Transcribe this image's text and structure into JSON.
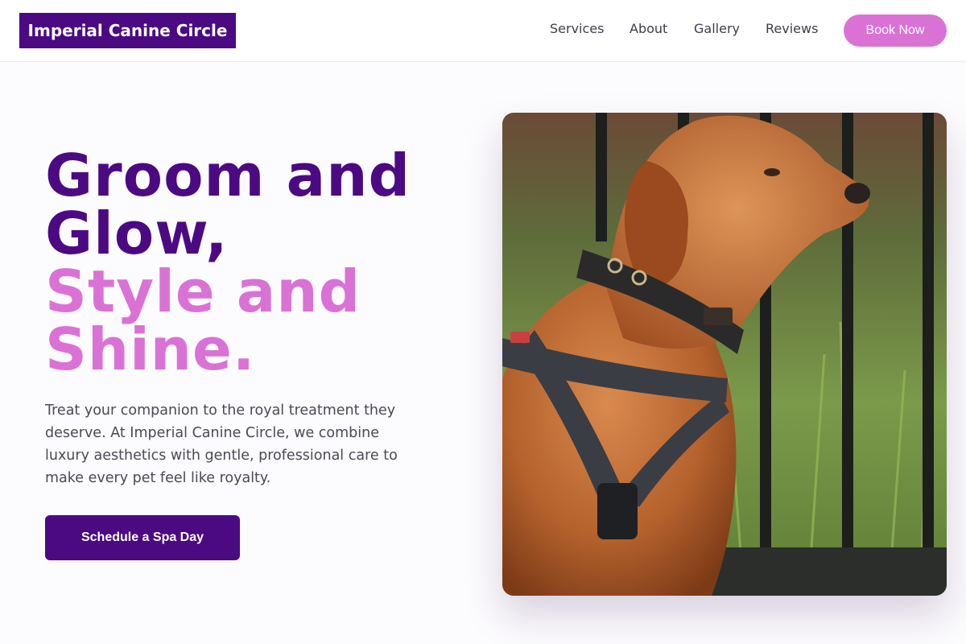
{
  "brand": {
    "name": "Imperial Canine Circle"
  },
  "nav": {
    "items": [
      {
        "label": "Services"
      },
      {
        "label": "About"
      },
      {
        "label": "Gallery"
      },
      {
        "label": "Reviews"
      }
    ],
    "cta_label": "Book Now"
  },
  "hero": {
    "title_line1": "Groom and",
    "title_line2": "Glow,",
    "title_line3": "Style and",
    "title_line4": "Shine.",
    "description": "Treat your companion to the royal treatment they deserve. At Imperial Canine Circle, we combine luxury aesthetics with gentle, professional care to make every pet feel like royalty.",
    "cta_label": "Schedule a Spa Day",
    "image": "photo of a red-coated dog wearing a collar and harness in front of a black metal fence"
  },
  "colors": {
    "brand_purple": "#4b0a82",
    "accent_pink": "#da72d6",
    "background": "#fcfbfd"
  }
}
